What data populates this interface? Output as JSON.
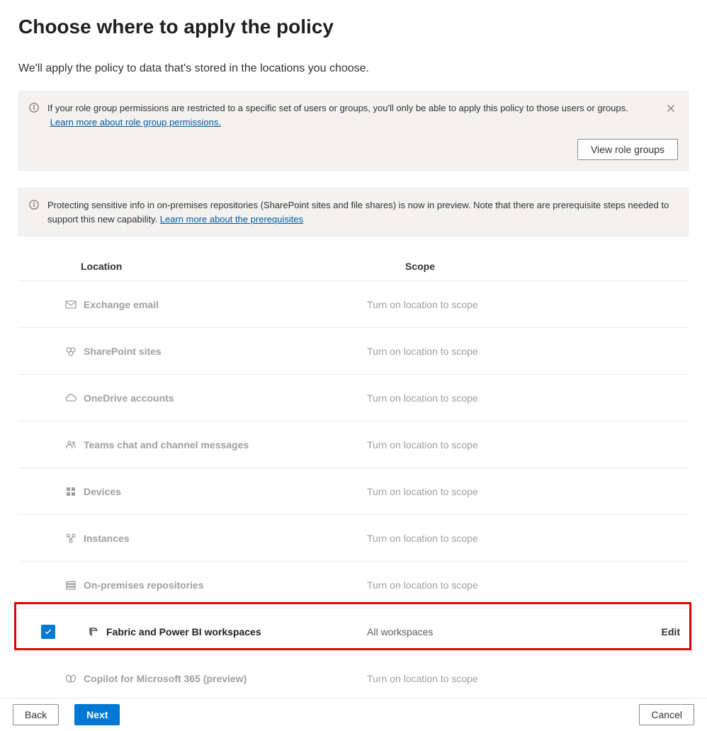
{
  "header": {
    "title": "Choose where to apply the policy",
    "subtitle": "We'll apply the policy to data that's stored in the locations you choose."
  },
  "infobar1": {
    "message": "If your role group permissions are restricted to a specific set of users or groups, you'll only be able to apply this policy to those users or groups.",
    "link_text": "Learn more about role group permissions.",
    "button_label": "View role groups"
  },
  "infobar2": {
    "message": "Protecting sensitive info in on-premises repositories (SharePoint sites and file shares) is now in preview. Note that there are prerequisite steps needed to support this new capability.",
    "link_text": "Learn more about the prerequisites"
  },
  "table": {
    "col_location": "Location",
    "col_scope": "Scope",
    "off_scope_text": "Turn on location to scope",
    "rows": [
      {
        "icon": "mail-icon",
        "name": "Exchange email",
        "enabled": false
      },
      {
        "icon": "sharepoint-icon",
        "name": "SharePoint sites",
        "enabled": false
      },
      {
        "icon": "cloud-icon",
        "name": "OneDrive accounts",
        "enabled": false
      },
      {
        "icon": "teams-icon",
        "name": "Teams chat and channel messages",
        "enabled": false
      },
      {
        "icon": "windows-icon",
        "name": "Devices",
        "enabled": false
      },
      {
        "icon": "instances-icon",
        "name": "Instances",
        "enabled": false
      },
      {
        "icon": "repo-icon",
        "name": "On-premises repositories",
        "enabled": false
      },
      {
        "icon": "fabric-icon",
        "name": "Fabric and Power BI workspaces",
        "enabled": true,
        "scope": "All workspaces",
        "action": "Edit"
      },
      {
        "icon": "copilot-icon",
        "name": "Copilot for Microsoft 365 (preview)",
        "enabled": false
      }
    ]
  },
  "footer": {
    "back": "Back",
    "next": "Next",
    "cancel": "Cancel"
  }
}
